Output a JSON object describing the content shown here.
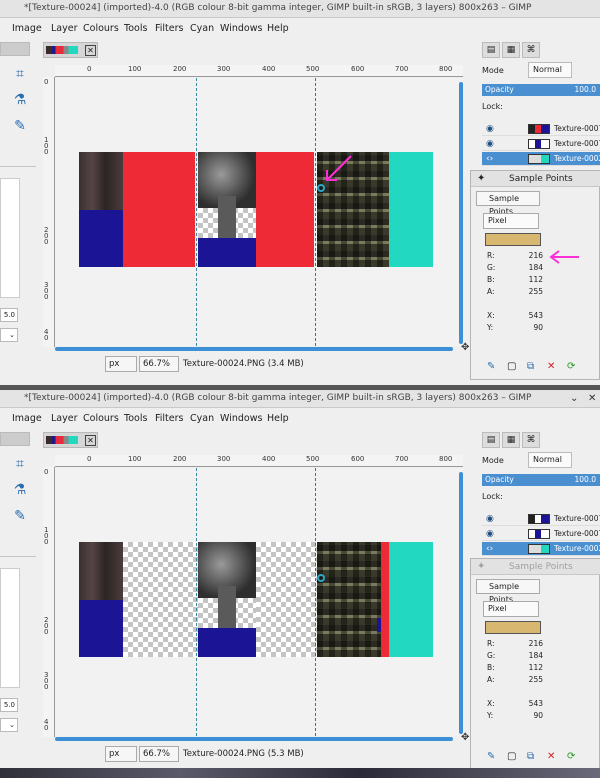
{
  "window": {
    "title_1": "*[Texture-00024] (imported)-4.0 (RGB colour 8-bit gamma integer, GIMP built-in sRGB, 3 layers) 800x263 – GIMP",
    "title_2": "*[Texture-00024] (imported)-4.0 (RGB colour 8-bit gamma integer, GIMP built-in sRGB, 3 layers) 800x263 – GIMP"
  },
  "menu": [
    "Image",
    "Layer",
    "Colours",
    "Tools",
    "Filters",
    "Cyan",
    "Windows",
    "Help"
  ],
  "ruler": {
    "h_labels": [
      "0",
      "100",
      "200",
      "300",
      "400",
      "500",
      "600",
      "700",
      "800"
    ],
    "v_labels": [
      "0",
      "1\n0\n0",
      "2\n0\n0",
      "3\n0\n0",
      "4\n0"
    ]
  },
  "toolbox": {
    "size_value": "5.0"
  },
  "status": {
    "unit": "px",
    "zoom": "66.7%",
    "file_1": "Texture-00024.PNG (3.4 MB)",
    "file_2": "Texture-00024.PNG (5.3 MB)"
  },
  "layers": {
    "mode_label": "Mode",
    "mode_value": "Normal",
    "opacity_label": "Opacity",
    "opacity_value": "100.0",
    "lock_label": "Lock:",
    "items": [
      "Texture-0007",
      "Texture-0007",
      "Texture-0002"
    ]
  },
  "sample_points": {
    "title": "Sample Points",
    "tab_label": "Sample Points",
    "mode": "Pixel",
    "swatch_color": "#d8b870",
    "labels": [
      "R:",
      "G:",
      "B:",
      "A:",
      "X:",
      "Y:"
    ],
    "r": "216",
    "g": "184",
    "b": "112",
    "a": "255",
    "x": "543",
    "y": "90"
  },
  "colors": {
    "red": "#ee2a36",
    "navy": "#1b1596",
    "cyan": "#22d8c0",
    "accent": "#3d8fd6",
    "annotation": "#ff2fd8"
  }
}
